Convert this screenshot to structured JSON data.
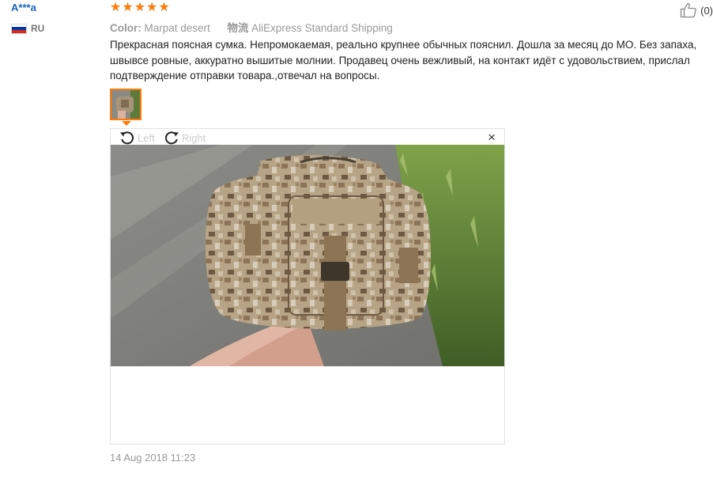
{
  "review": {
    "user_name": "A***a",
    "country_code": "RU",
    "rating": 5,
    "color_label": "Color:",
    "color_value": "Marpat desert",
    "shipping_label": "物流",
    "shipping_value": "AliExpress Standard Shipping",
    "helpful_count": "(0)",
    "text": "Прекрасная поясная сумка. Непромокаемая, реально крупнее обычных пояснил. Дошла за месяц до МО. Без запаха, швывсе ровные, аккуратно вышитые молнии. Продавец очень вежливый, на контакт идёт с удовольствием, прислал подтверждение отправки товара.,отвечал на вопросы.",
    "date": "14 Aug 2018 11:23"
  },
  "viewer": {
    "rotate_left_label": "Left",
    "rotate_right_label": "Right",
    "close_glyph": "×"
  },
  "colors": {
    "accent": "#ff7a0a",
    "username": "#1a66c2",
    "flag_ru": [
      "#ffffff",
      "#0039a6",
      "#d52b1e"
    ]
  }
}
